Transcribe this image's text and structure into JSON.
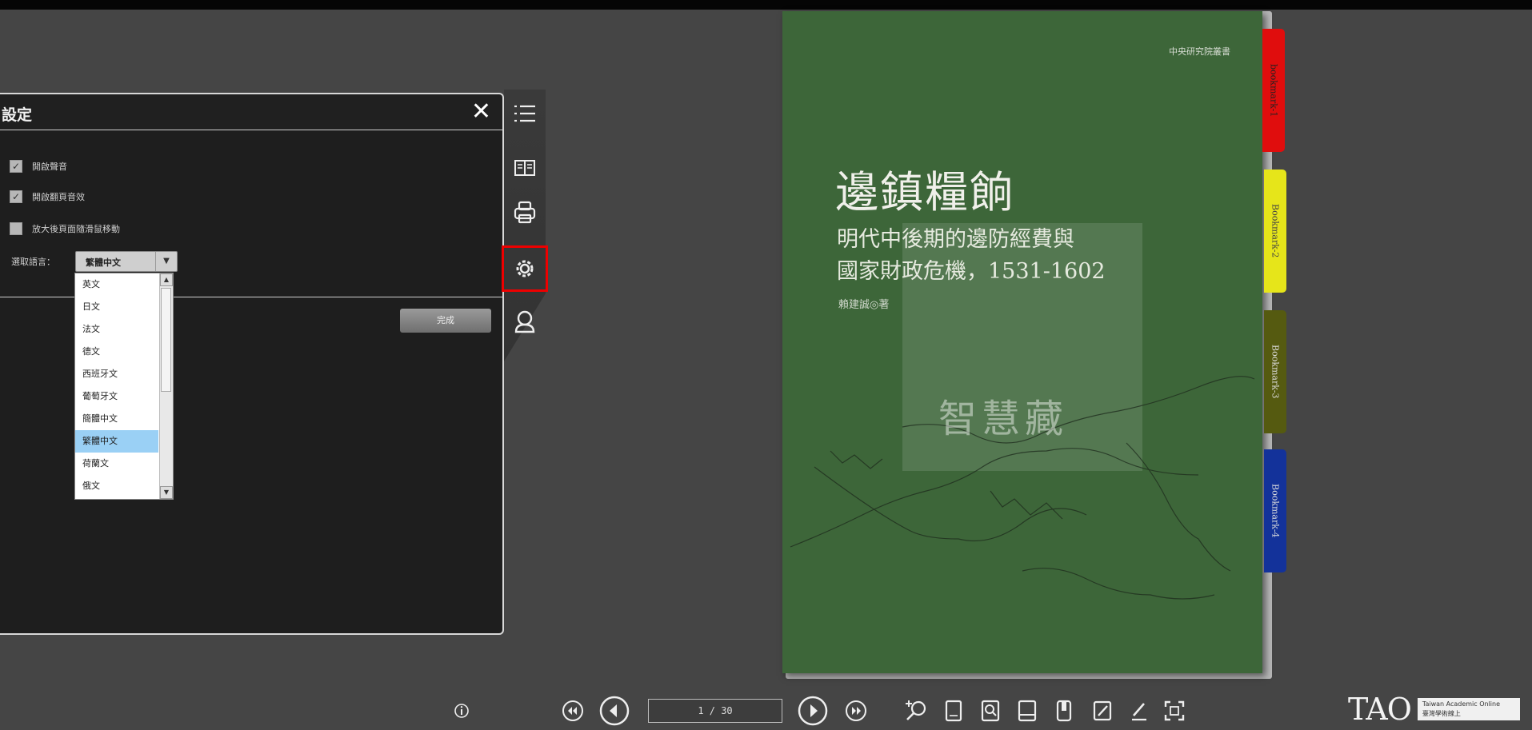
{
  "settings_panel": {
    "title": "設定",
    "options": [
      {
        "label": "開啟聲音",
        "checked": true
      },
      {
        "label": "開啟翻頁音效",
        "checked": true
      },
      {
        "label": "放大後頁面隨滑鼠移動",
        "checked": false
      }
    ],
    "language_label": "選取語言：",
    "language_selected": "繁體中文",
    "done_label": "完成",
    "language_options": [
      "英文",
      "日文",
      "法文",
      "德文",
      "西班牙文",
      "葡萄牙文",
      "簡體中文",
      "繁體中文",
      "荷蘭文",
      "俄文"
    ]
  },
  "side_toolbar": {
    "items": [
      {
        "icon": "toc-list-icon",
        "active": false
      },
      {
        "icon": "two-page-book-icon",
        "active": false
      },
      {
        "icon": "print-icon",
        "active": false
      },
      {
        "icon": "settings-gear-icon",
        "active": true
      },
      {
        "icon": "user-icon",
        "active": false
      }
    ]
  },
  "book": {
    "publisher": "中央研究院叢書",
    "title": "邊鎮糧餉",
    "subtitle_line1": "明代中後期的邊防經費與",
    "subtitle_line2": "國家財政危機，1531-1602",
    "author": "賴建誠◎著",
    "watermark": "智慧藏",
    "cover_color": "#3d6639"
  },
  "bookmarks": [
    {
      "label": "bookmark-1",
      "color": "#e00d0d"
    },
    {
      "label": "Bookmark-2",
      "color": "#e6e51a"
    },
    {
      "label": "Bookmark-3",
      "color": "#555a10"
    },
    {
      "label": "Bookmark-4",
      "color": "#13329a"
    }
  ],
  "bottom_toolbar": {
    "page_indicator": "1 / 30"
  },
  "logo": {
    "mark": "TAO",
    "line1": "Taiwan Academic Online",
    "line2": "臺灣學術線上"
  }
}
